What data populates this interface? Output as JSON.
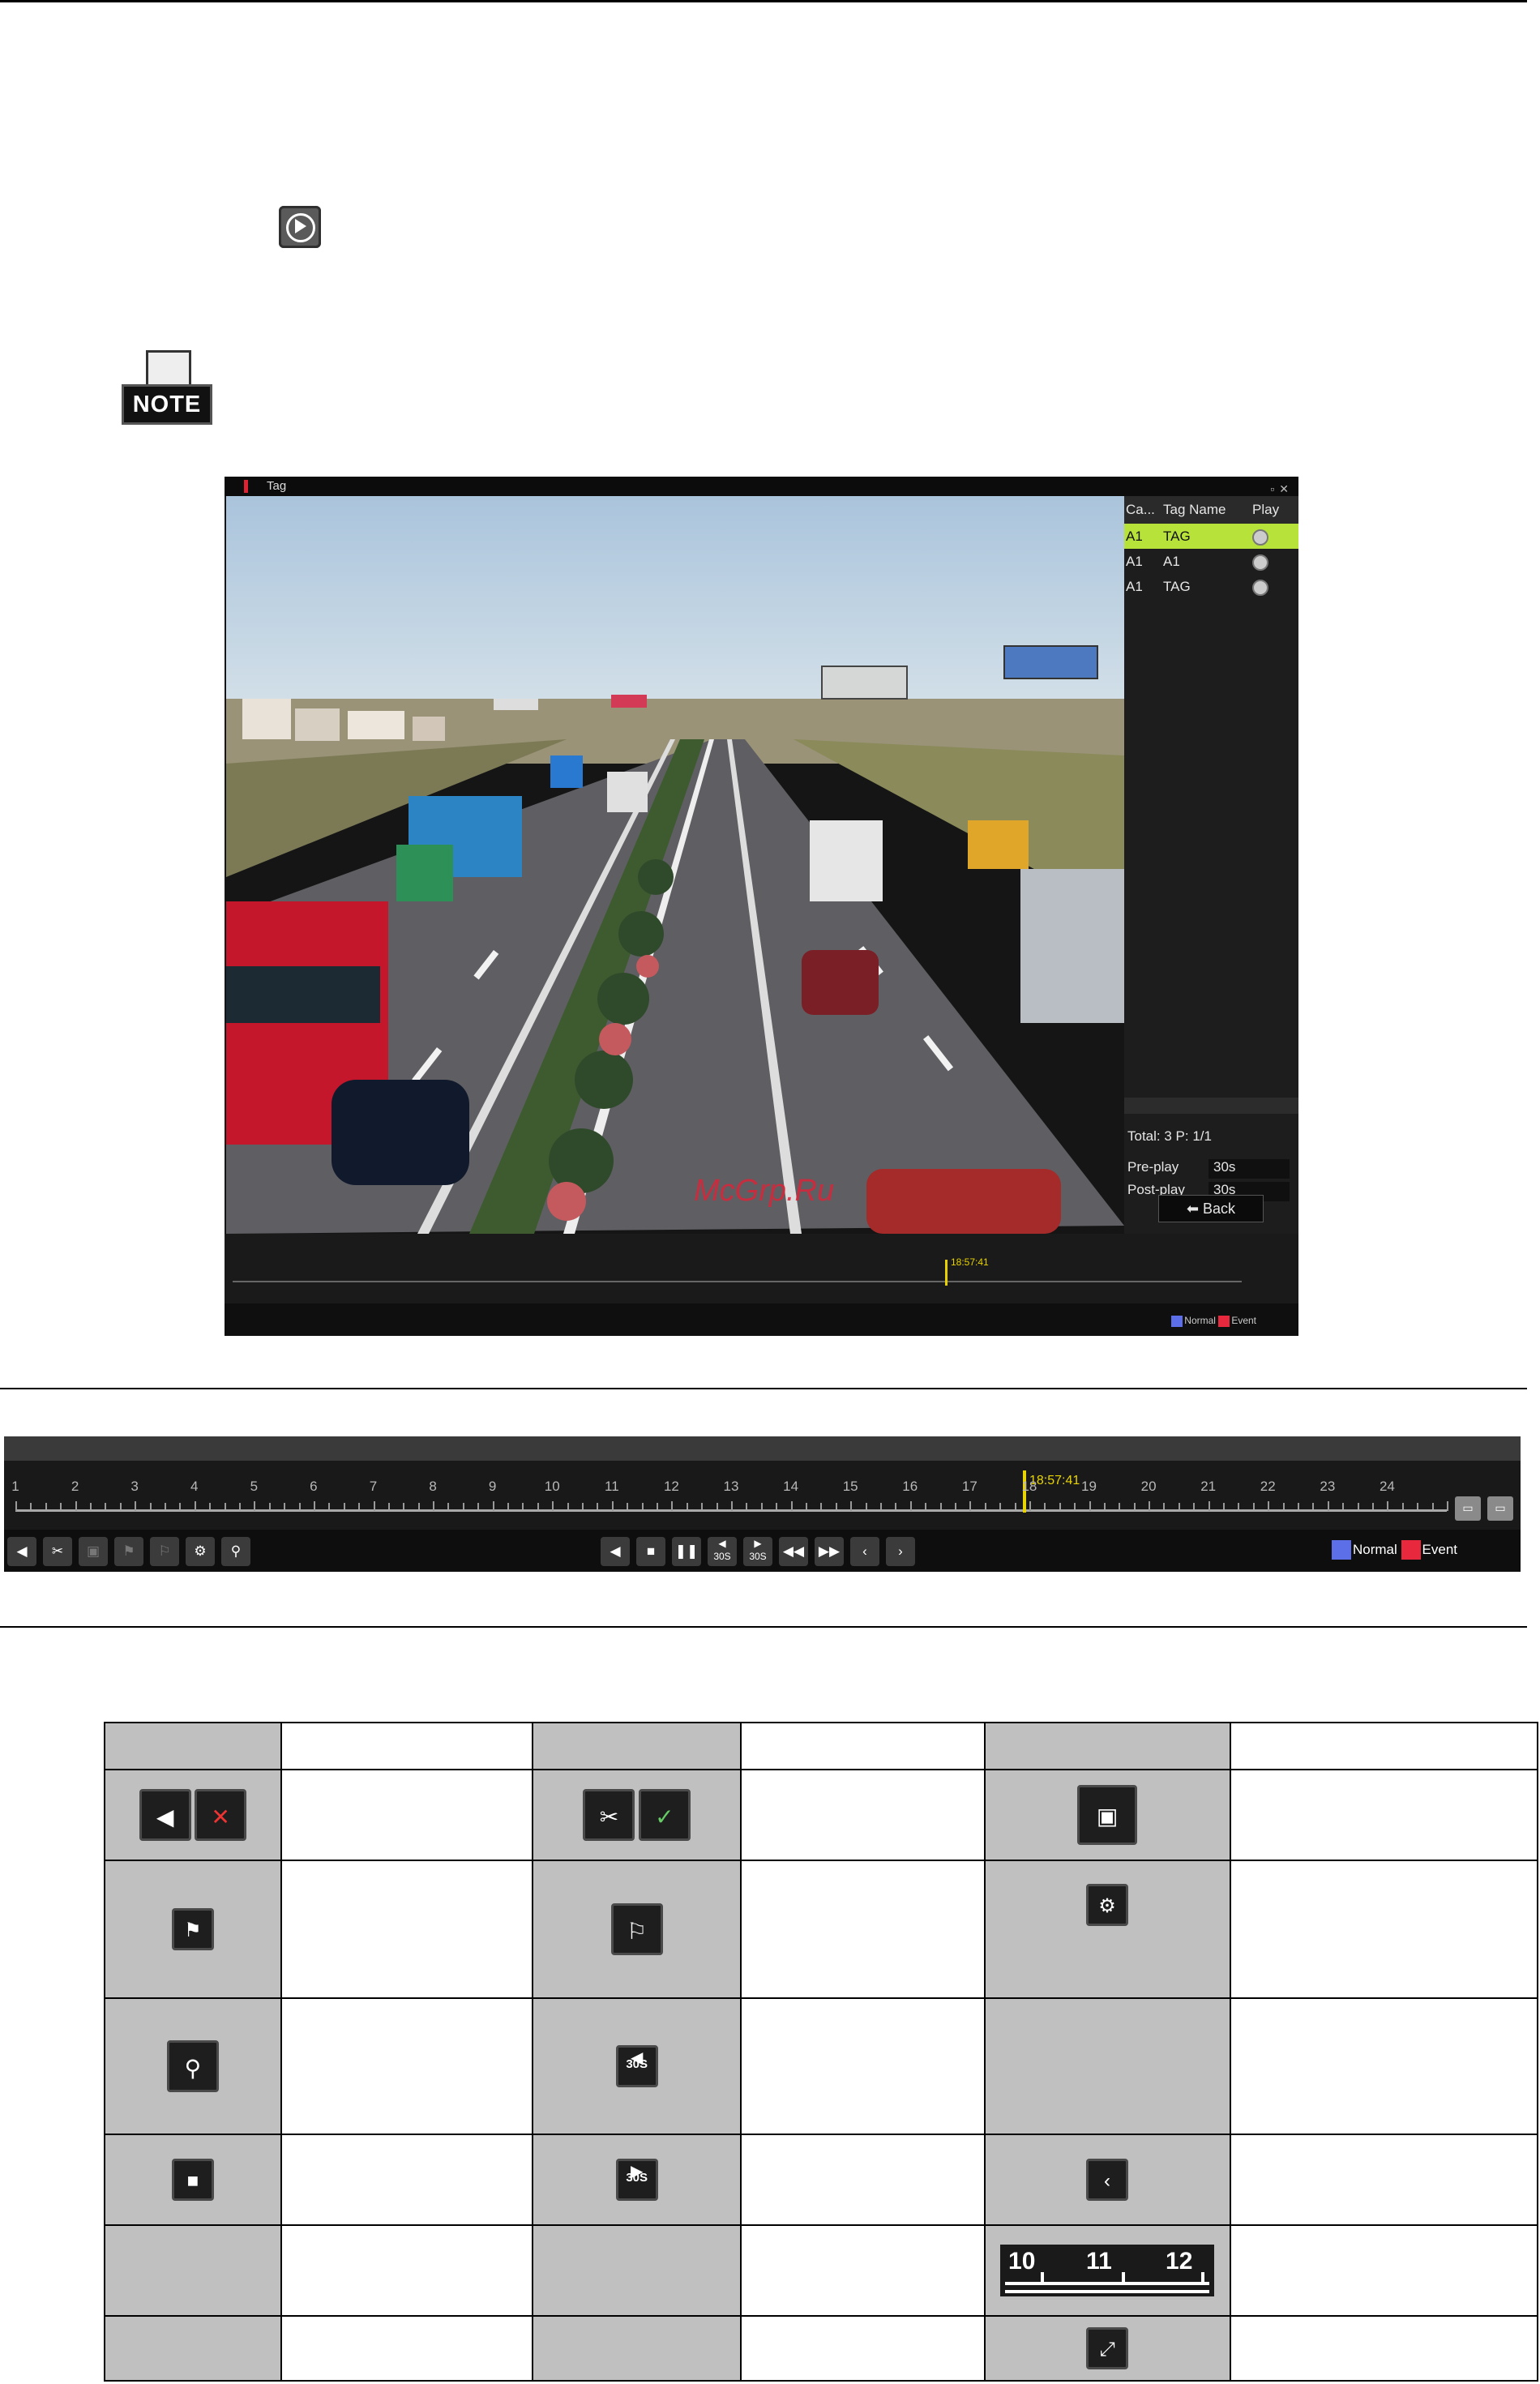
{
  "tag_window": {
    "title": "Tag",
    "list_headers": [
      "Ca...",
      "Tag Name",
      "Play"
    ],
    "tags": [
      {
        "camera": "A1",
        "name": "TAG",
        "selected": true
      },
      {
        "camera": "A1",
        "name": "A1",
        "selected": false
      },
      {
        "camera": "A1",
        "name": "TAG",
        "selected": false
      }
    ],
    "total_text": "Total: 3  P: 1/1",
    "preplay_label": "Pre-play",
    "preplay_value": "30s",
    "postplay_label": "Post-play",
    "postplay_value": "30s",
    "back_label": "Back",
    "timeline_time": "18:57:41",
    "legend_normal": "Normal",
    "legend_event": "Event"
  },
  "watermark": "McGrp.Ru",
  "control_bar": {
    "current_time": "18:57:41",
    "hours": [
      "1",
      "2",
      "3",
      "4",
      "5",
      "6",
      "7",
      "8",
      "9",
      "10",
      "11",
      "12",
      "13",
      "14",
      "15",
      "16",
      "17",
      "18",
      "19",
      "20",
      "21",
      "22",
      "23",
      "24"
    ],
    "legend_normal": "Normal",
    "legend_event": "Event",
    "colors": {
      "normal": "#5c6fe8",
      "event": "#e8283c",
      "cursor": "#e8d400"
    }
  },
  "icon_table": {
    "badge_30s": "30S",
    "scale_labels": [
      "10",
      "11",
      "12"
    ]
  }
}
